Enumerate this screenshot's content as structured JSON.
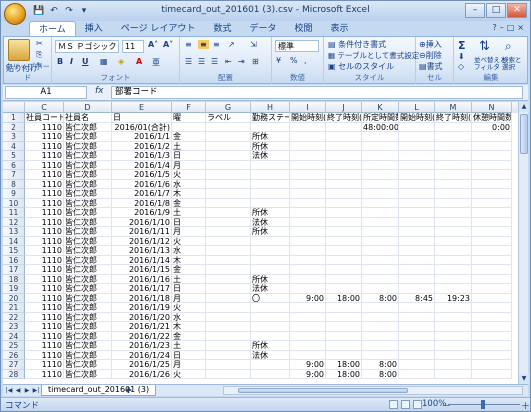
{
  "window": {
    "title": "timecard_out_201601 (3).csv - Microsoft Excel"
  },
  "qat": [
    "💾",
    "↶",
    "↷",
    "▾"
  ],
  "window_controls": [
    "–",
    "□",
    "✕"
  ],
  "tabs": [
    "ホーム",
    "挿入",
    "ページ レイアウト",
    "数式",
    "データ",
    "校閲",
    "表示"
  ],
  "active_tab": "ホーム",
  "ribbon": {
    "clipboard": {
      "paste": "貼り付け",
      "label": "クリップボード"
    },
    "font": {
      "name": "ＭＳ Ｐゴシック",
      "size": "11",
      "bold": "B",
      "italic": "I",
      "underline": "U",
      "label": "フォント"
    },
    "alignment": {
      "label": "配置"
    },
    "number": {
      "format": "標準",
      "label": "数値"
    },
    "style": {
      "conditional": "条件付き書式",
      "table": "テーブルとして書式設定",
      "cell": "セルのスタイル",
      "label": "スタイル"
    },
    "cells": {
      "insert": "挿入",
      "delete": "削除",
      "format": "書式",
      "label": "セル"
    },
    "editing": {
      "sum": "Σ",
      "sort": "並べ替えと\nフィルタ",
      "find": "検索と\n選択",
      "label": "編集"
    }
  },
  "formula_bar": {
    "name_box": "A1",
    "fx": "fx",
    "content": "部署コード"
  },
  "columns": [
    "C",
    "D",
    "E",
    "F",
    "G",
    "H",
    "I",
    "J",
    "K",
    "L",
    "M",
    "N"
  ],
  "header_row": [
    "社員コード",
    "社員名",
    "日",
    "曜",
    "ラベル",
    "勤務ステー",
    "開始時刻(",
    "終了時刻(",
    "所定時間数",
    "開始時刻(",
    "終了時刻(",
    "休憩時間数"
  ],
  "rows": [
    {
      "n": "2",
      "c": "1110",
      "d": "皆仁次郎",
      "e": "2016/01(合計)",
      "f": "",
      "h": "",
      "i": "",
      "j": "",
      "k": "48:00:00",
      "l": "",
      "m": "",
      "nn": "0:00"
    },
    {
      "n": "3",
      "c": "1110",
      "d": "皆仁次郎",
      "e": "2016/1/1",
      "f": "金",
      "h": "所休"
    },
    {
      "n": "4",
      "c": "1110",
      "d": "皆仁次郎",
      "e": "2016/1/2",
      "f": "土",
      "h": "所休"
    },
    {
      "n": "5",
      "c": "1110",
      "d": "皆仁次郎",
      "e": "2016/1/3",
      "f": "日",
      "h": "法休"
    },
    {
      "n": "6",
      "c": "1110",
      "d": "皆仁次郎",
      "e": "2016/1/4",
      "f": "月"
    },
    {
      "n": "7",
      "c": "1110",
      "d": "皆仁次郎",
      "e": "2016/1/5",
      "f": "火"
    },
    {
      "n": "8",
      "c": "1110",
      "d": "皆仁次郎",
      "e": "2016/1/6",
      "f": "水"
    },
    {
      "n": "9",
      "c": "1110",
      "d": "皆仁次郎",
      "e": "2016/1/7",
      "f": "木"
    },
    {
      "n": "10",
      "c": "1110",
      "d": "皆仁次郎",
      "e": "2016/1/8",
      "f": "金"
    },
    {
      "n": "11",
      "c": "1110",
      "d": "皆仁次郎",
      "e": "2016/1/9",
      "f": "土",
      "h": "所休"
    },
    {
      "n": "12",
      "c": "1110",
      "d": "皆仁次郎",
      "e": "2016/1/10",
      "f": "日",
      "h": "法休"
    },
    {
      "n": "13",
      "c": "1110",
      "d": "皆仁次郎",
      "e": "2016/1/11",
      "f": "月",
      "h": "所休"
    },
    {
      "n": "14",
      "c": "1110",
      "d": "皆仁次郎",
      "e": "2016/1/12",
      "f": "火"
    },
    {
      "n": "15",
      "c": "1110",
      "d": "皆仁次郎",
      "e": "2016/1/13",
      "f": "水"
    },
    {
      "n": "16",
      "c": "1110",
      "d": "皆仁次郎",
      "e": "2016/1/14",
      "f": "木"
    },
    {
      "n": "17",
      "c": "1110",
      "d": "皆仁次郎",
      "e": "2016/1/15",
      "f": "金"
    },
    {
      "n": "18",
      "c": "1110",
      "d": "皆仁次郎",
      "e": "2016/1/16",
      "f": "土",
      "h": "所休"
    },
    {
      "n": "19",
      "c": "1110",
      "d": "皆仁次郎",
      "e": "2016/1/17",
      "f": "日",
      "h": "法休"
    },
    {
      "n": "20",
      "c": "1110",
      "d": "皆仁次郎",
      "e": "2016/1/18",
      "f": "月",
      "h": "〇",
      "i": "9:00",
      "j": "18:00",
      "k": "8:00",
      "l": "8:45",
      "m": "19:23"
    },
    {
      "n": "21",
      "c": "1110",
      "d": "皆仁次郎",
      "e": "2016/1/19",
      "f": "火"
    },
    {
      "n": "22",
      "c": "1110",
      "d": "皆仁次郎",
      "e": "2016/1/20",
      "f": "水"
    },
    {
      "n": "23",
      "c": "1110",
      "d": "皆仁次郎",
      "e": "2016/1/21",
      "f": "木"
    },
    {
      "n": "24",
      "c": "1110",
      "d": "皆仁次郎",
      "e": "2016/1/22",
      "f": "金"
    },
    {
      "n": "25",
      "c": "1110",
      "d": "皆仁次郎",
      "e": "2016/1/23",
      "f": "土",
      "h": "所休"
    },
    {
      "n": "26",
      "c": "1110",
      "d": "皆仁次郎",
      "e": "2016/1/24",
      "f": "日",
      "h": "法休"
    },
    {
      "n": "27",
      "c": "1110",
      "d": "皆仁次郎",
      "e": "2016/1/25",
      "f": "月",
      "i": "9:00",
      "j": "18:00",
      "k": "8:00"
    },
    {
      "n": "28",
      "c": "1110",
      "d": "皆仁次郎",
      "e": "2016/1/26",
      "f": "火",
      "i": "9:00",
      "j": "18:00",
      "k": "8:00"
    }
  ],
  "sheet": {
    "tab": "timecard_out_201601 (3)",
    "nav": [
      "|◀",
      "◀",
      "▶",
      "▶|"
    ]
  },
  "status": {
    "mode": "コマンド",
    "zoom": "100%",
    "minus": "－",
    "plus": "＋"
  }
}
